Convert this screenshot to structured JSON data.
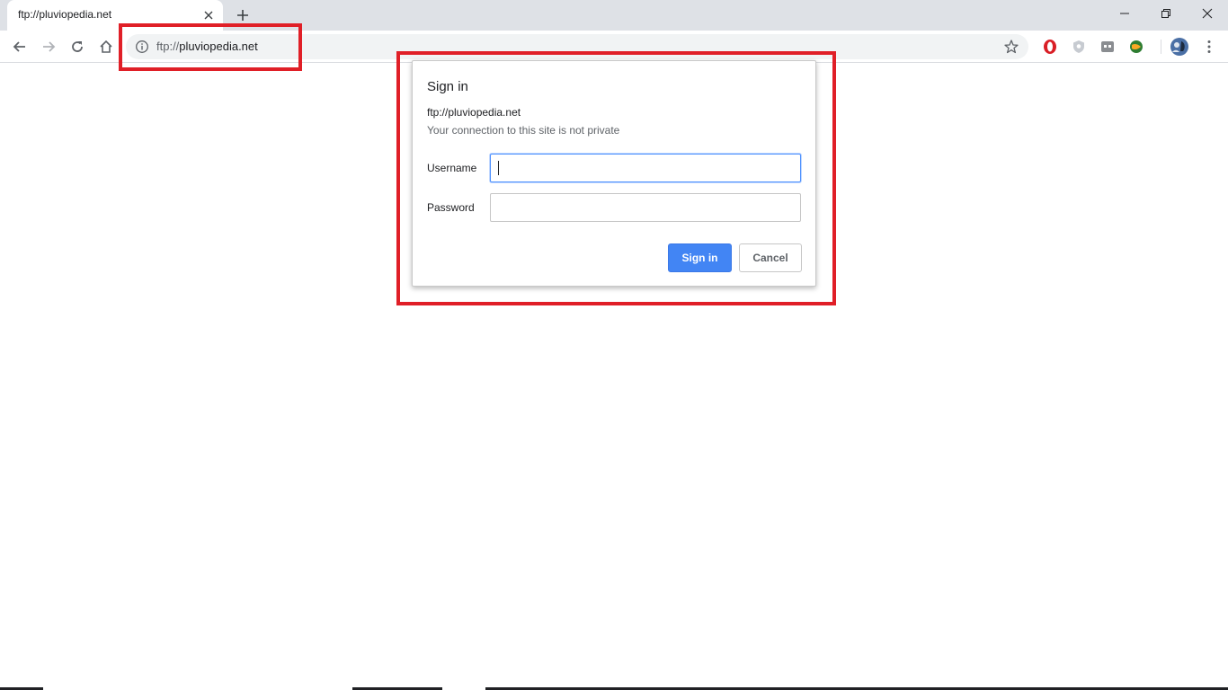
{
  "tab": {
    "title": "ftp://pluviopedia.net"
  },
  "omnibox": {
    "scheme": "ftp://",
    "host": "pluviopedia.net"
  },
  "dialog": {
    "title": "Sign in",
    "origin": "ftp://pluviopedia.net",
    "warning": "Your connection to this site is not private",
    "username_label": "Username",
    "password_label": "Password",
    "username_value": "",
    "password_value": "",
    "signin_label": "Sign in",
    "cancel_label": "Cancel"
  },
  "colors": {
    "highlight": "#e01f27",
    "primary_button": "#4285f4",
    "tabstrip": "#dee1e6"
  },
  "icons": [
    "close-icon",
    "plus-icon",
    "minimize-icon",
    "restore-icon",
    "window-close-icon",
    "back-arrow-icon",
    "forward-arrow-icon",
    "reload-icon",
    "home-icon",
    "info-icon",
    "star-icon",
    "opera-extension-icon",
    "shield-extension-icon",
    "gamepad-extension-icon",
    "globe-extension-icon",
    "profile-avatar-icon",
    "kebab-menu-icon"
  ]
}
